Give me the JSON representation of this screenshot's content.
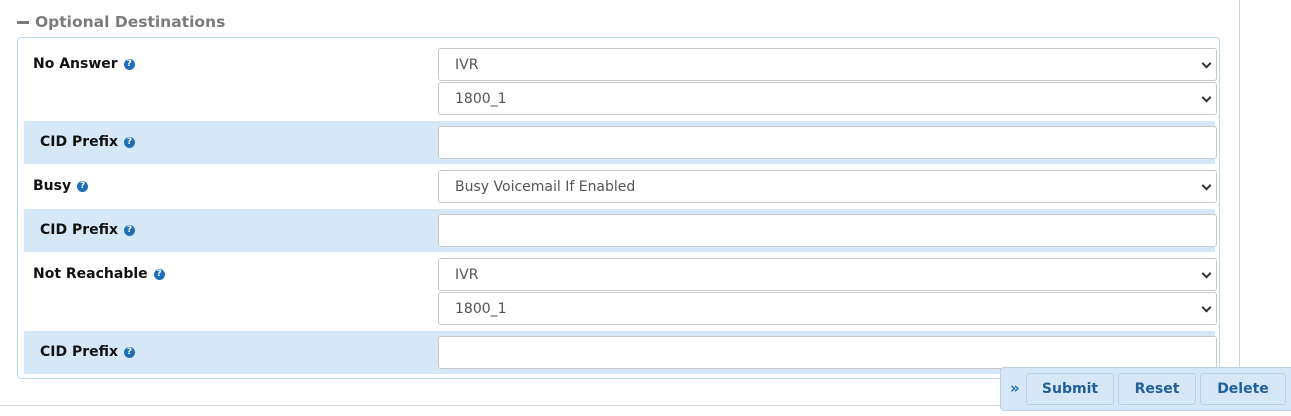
{
  "section": {
    "title": "Optional Destinations"
  },
  "rows": {
    "no_answer": {
      "label": "No Answer",
      "select1": "IVR",
      "select2": "1800_1"
    },
    "cid_prefix_1": {
      "label": "CID Prefix",
      "value": ""
    },
    "busy": {
      "label": "Busy",
      "select1": "Busy Voicemail If Enabled"
    },
    "cid_prefix_2": {
      "label": "CID Prefix",
      "value": ""
    },
    "not_reachable": {
      "label": "Not Reachable",
      "select1": "IVR",
      "select2": "1800_1"
    },
    "cid_prefix_3": {
      "label": "CID Prefix",
      "value": ""
    }
  },
  "actions": {
    "submit": "Submit",
    "reset": "Reset",
    "delete": "Delete"
  },
  "icons": {
    "help": "?",
    "expand": "»"
  },
  "colors": {
    "accent": "#1f6fb5",
    "shaded_row": "#d6e8f8",
    "header_text": "#7b7b7b"
  }
}
